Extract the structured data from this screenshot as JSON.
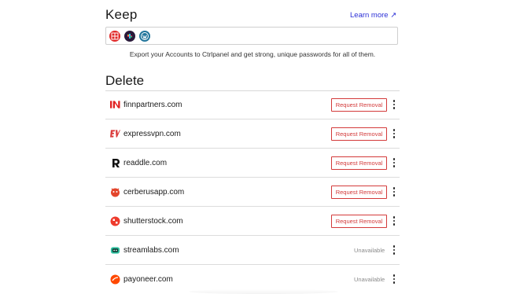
{
  "keep": {
    "title": "Keep",
    "learn_more": "Learn more ↗",
    "icons": [
      "flipboard-icon",
      "slack-icon",
      "wordpress-icon"
    ],
    "export_text": "Export your Accounts to Ctrlpanel and get strong, unique passwords for all of them."
  },
  "delete": {
    "title": "Delete",
    "rows": [
      {
        "domain": "finnpartners.com",
        "action": "Request Removal",
        "logo": "finnpartners-logo",
        "color": "#e02020"
      },
      {
        "domain": "expressvpn.com",
        "action": "Request Removal",
        "logo": "expressvpn-logo",
        "color": "#da3b3b"
      },
      {
        "domain": "readdle.com",
        "action": "Request Removal",
        "logo": "readdle-logo",
        "color": "#111111"
      },
      {
        "domain": "cerberusapp.com",
        "action": "Request Removal",
        "logo": "cerberus-logo",
        "color": "#e3452c"
      },
      {
        "domain": "shutterstock.com",
        "action": "Request Removal",
        "logo": "shutterstock-logo",
        "color": "#ee3a2c"
      },
      {
        "domain": "streamlabs.com",
        "action": "Unavailable",
        "logo": "streamlabs-logo",
        "color": "#31c3a2"
      },
      {
        "domain": "payoneer.com",
        "action": "Unavailable",
        "logo": "payoneer-logo",
        "color": "#ff4800"
      }
    ]
  },
  "colors": {
    "accent_link": "#2b2fd6",
    "danger": "#d33a3a",
    "muted": "#8a8a8a"
  }
}
